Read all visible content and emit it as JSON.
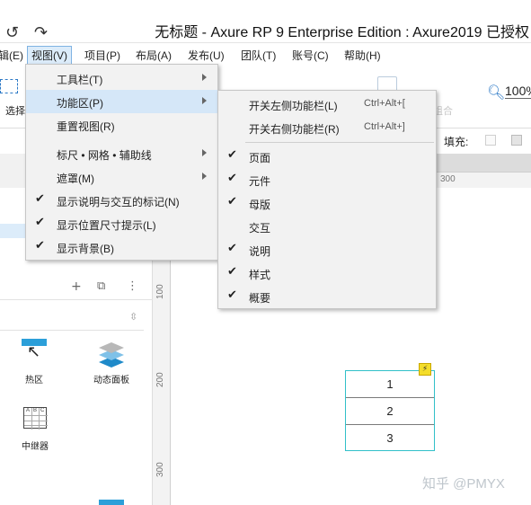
{
  "titlebar": {
    "undo_icon": "undo-icon",
    "redo_icon": "redo-icon",
    "title": "无标题 - Axure RP 9 Enterprise Edition : Axure2019 已授权"
  },
  "menubar": [
    {
      "label": "辑(E)"
    },
    {
      "label": "视图(V)"
    },
    {
      "label": "项目(P)"
    },
    {
      "label": "布局(A)"
    },
    {
      "label": "发布(U)"
    },
    {
      "label": "团队(T)"
    },
    {
      "label": "账号(C)"
    },
    {
      "label": "帮助(H)"
    }
  ],
  "toolbar": {
    "select_label": "选择",
    "zoom_value": "100%",
    "faded_label": "组合"
  },
  "stylebar": {
    "fill_label": "填充:"
  },
  "ruler": {
    "h_tick": "300",
    "v_ticks": [
      "100",
      "200",
      "300"
    ]
  },
  "library": {
    "widgets": [
      {
        "label": "热区",
        "icon": "hotspot-icon"
      },
      {
        "label": "动态面板",
        "icon": "dynamic-panel-icon"
      },
      {
        "label": "中继器",
        "icon": "repeater-icon"
      }
    ]
  },
  "canvas": {
    "repeater_rows": [
      "1",
      "2",
      "3"
    ],
    "watermark": "知乎 @PMYX"
  },
  "view_menu": {
    "items": [
      {
        "label": "工具栏(T)",
        "check": "",
        "submenu": true
      },
      {
        "label": "功能区(P)",
        "check": "",
        "submenu": true
      },
      {
        "label": "重置视图(R)",
        "check": "",
        "submenu": false
      },
      {
        "label": "标尺 • 网格 • 辅助线",
        "check": "",
        "submenu": true
      },
      {
        "label": "遮罩(M)",
        "check": "",
        "submenu": true
      },
      {
        "label": "显示说明与交互的标记(N)",
        "check": "✔",
        "submenu": false
      },
      {
        "label": "显示位置尺寸提示(L)",
        "check": "✔",
        "submenu": false
      },
      {
        "label": "显示背景(B)",
        "check": "✔",
        "submenu": false
      }
    ]
  },
  "function_menu": {
    "items": [
      {
        "label": "开关左侧功能栏(L)",
        "shortcut": "Ctrl+Alt+[",
        "check": ""
      },
      {
        "label": "开关右侧功能栏(R)",
        "shortcut": "Ctrl+Alt+]",
        "check": ""
      },
      {
        "label": "页面",
        "shortcut": "",
        "check": "✔"
      },
      {
        "label": "元件",
        "shortcut": "",
        "check": "✔"
      },
      {
        "label": "母版",
        "shortcut": "",
        "check": "✔"
      },
      {
        "label": "交互",
        "shortcut": "",
        "check": ""
      },
      {
        "label": "说明",
        "shortcut": "",
        "check": "✔"
      },
      {
        "label": "样式",
        "shortcut": "",
        "check": "✔"
      },
      {
        "label": "概要",
        "shortcut": "",
        "check": "✔"
      }
    ]
  }
}
